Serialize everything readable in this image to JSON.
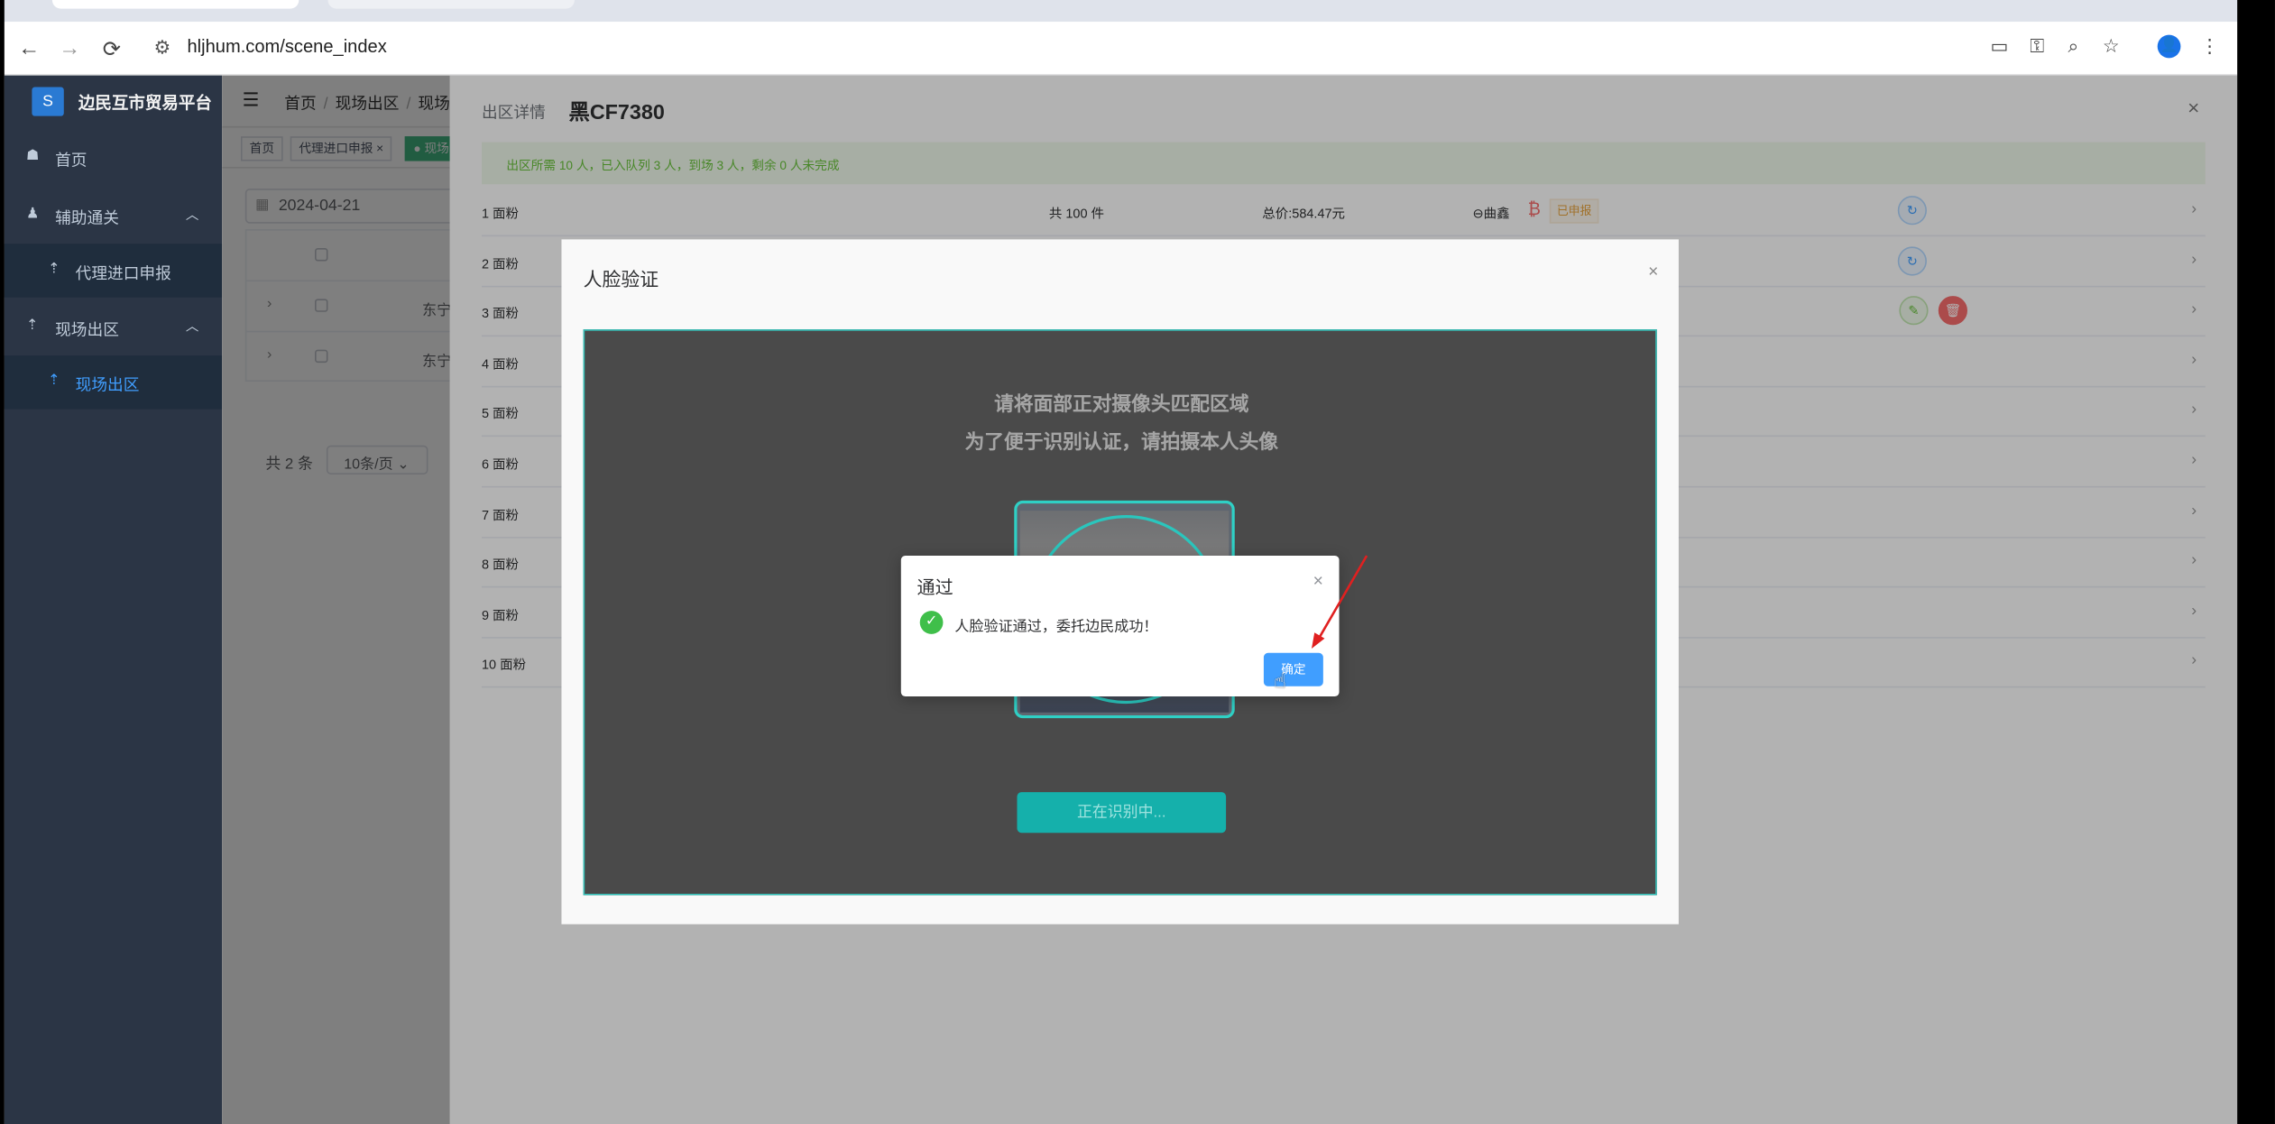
{
  "browser": {
    "url": "hljhum.com/scene_index",
    "nav_back": "←",
    "nav_forward": "→",
    "nav_reload": "⟳",
    "site_icon": "⚙",
    "right_icons": [
      "▭",
      "⚿",
      "⌕",
      "☆"
    ],
    "profile_icon": "👤",
    "menu_icon": "⋮"
  },
  "sidebar": {
    "app_title": "边民互市贸易平台",
    "logo_glyph": "S",
    "items": [
      {
        "icon": "☗",
        "label": "首页"
      },
      {
        "icon": "♟",
        "label": "辅助通关",
        "arrow": "︿"
      },
      {
        "icon": "⇡",
        "label": "代理进口申报"
      },
      {
        "icon": "⇡",
        "label": "现场出区",
        "arrow": "︿"
      },
      {
        "icon": "⇡",
        "label": "现场出区"
      }
    ]
  },
  "topbar": {
    "hamburger": "☰",
    "breadcrumb": [
      "首页",
      "现场出区",
      "现场"
    ],
    "sep": "/"
  },
  "tags": [
    "首页",
    "代理进口申报 ×",
    "● 现场"
  ],
  "filter": {
    "date": "2024-04-21",
    "cal_icon": "▦"
  },
  "bgtable": {
    "rows": [
      "东宁",
      "东宁"
    ],
    "expand": "›"
  },
  "pager": {
    "total": "共 2 条",
    "page_size": "10条/页",
    "caret": "⌄"
  },
  "drawer": {
    "label": "出区详情",
    "plate": "黑CF7380",
    "close": "×",
    "notice": "出区所需 10 人，已入队列 3 人，到场 3 人，剩余 0 人未完成",
    "rows": [
      {
        "n": "1 面粉",
        "count": "共 100 件",
        "price": "总价:584.47元",
        "user": "⊖曲鑫",
        "btc": "₿",
        "status": "已申报",
        "actions": [
          "refresh"
        ]
      },
      {
        "n": "2 面粉",
        "actions": [
          "refresh"
        ]
      },
      {
        "n": "3 面粉",
        "actions": [
          "green",
          "red"
        ]
      },
      {
        "n": "4 面粉",
        "actions": []
      },
      {
        "n": "5 面粉",
        "actions": []
      },
      {
        "n": "6 面粉",
        "actions": []
      },
      {
        "n": "7 面粉",
        "actions": []
      },
      {
        "n": "8 面粉",
        "actions": []
      },
      {
        "n": "9 面粉",
        "actions": []
      },
      {
        "n": "10 面粉",
        "actions": []
      }
    ],
    "chevron": "›",
    "icons": {
      "refresh": "↻",
      "green": "✎",
      "red": "🗑"
    }
  },
  "face_dialog": {
    "title": "人脸验证",
    "close": "×",
    "hint_line1": "请将面部正对摄像头匹配区域",
    "hint_line2": "为了便于识别认证，请拍摄本人头像",
    "scan_button": "正在识别中..."
  },
  "pass_dialog": {
    "title": "通过",
    "close": "×",
    "check": "✓",
    "message": "人脸验证通过，委托边民成功！",
    "confirm": "确定",
    "cursor": "☝"
  },
  "colors": {
    "sidebar_bg": "#2b3545",
    "accent": "#409eff",
    "success": "#67c23a",
    "danger": "#f56c6c",
    "teal": "#15b0ab"
  }
}
